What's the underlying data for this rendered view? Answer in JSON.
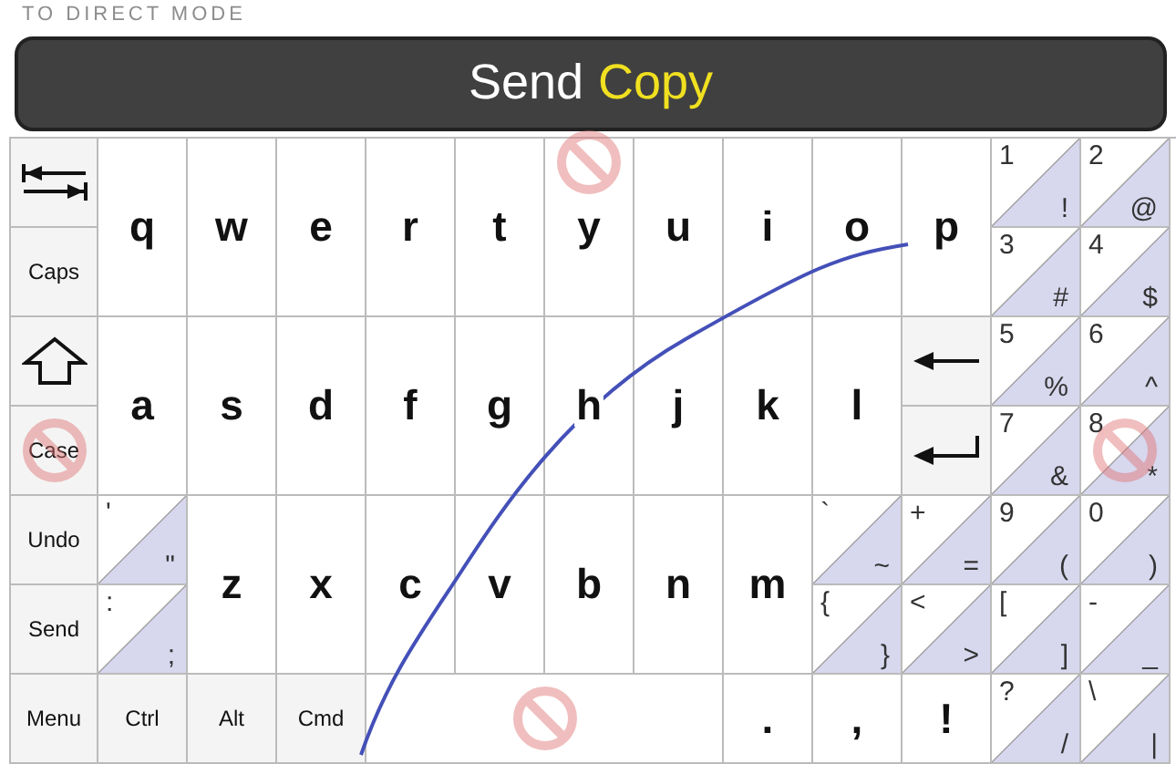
{
  "hint": "TO DIRECT MODE",
  "title": {
    "action": "Send",
    "mode": "Copy"
  },
  "keys": [
    {
      "kind": "tab"
    },
    {
      "kind": "letter",
      "label": "q"
    },
    {
      "kind": "letter",
      "label": "w"
    },
    {
      "kind": "letter",
      "label": "e"
    },
    {
      "kind": "letter",
      "label": "r"
    },
    {
      "kind": "letter",
      "label": "t"
    },
    {
      "kind": "letter",
      "label": "y",
      "blocked": true
    },
    {
      "kind": "letter",
      "label": "u"
    },
    {
      "kind": "letter",
      "label": "i"
    },
    {
      "kind": "letter",
      "label": "o"
    },
    {
      "kind": "letter",
      "label": "p"
    },
    {
      "kind": "split",
      "upper": "1",
      "lower": "!"
    },
    {
      "kind": "split",
      "upper": "2",
      "lower": "@"
    },
    {
      "kind": "label",
      "label": "Caps"
    },
    {
      "kind": "split",
      "upper": "3",
      "lower": "#"
    },
    {
      "kind": "split",
      "upper": "4",
      "lower": "$"
    },
    {
      "kind": "shift"
    },
    {
      "kind": "letter",
      "label": "a"
    },
    {
      "kind": "letter",
      "label": "s"
    },
    {
      "kind": "letter",
      "label": "d"
    },
    {
      "kind": "letter",
      "label": "f"
    },
    {
      "kind": "letter",
      "label": "g"
    },
    {
      "kind": "letter",
      "label": "h"
    },
    {
      "kind": "letter",
      "label": "j"
    },
    {
      "kind": "letter",
      "label": "k"
    },
    {
      "kind": "letter",
      "label": "l"
    },
    {
      "kind": "backspace"
    },
    {
      "kind": "split",
      "upper": "5",
      "lower": "%"
    },
    {
      "kind": "split",
      "upper": "6",
      "lower": "^"
    },
    {
      "kind": "label",
      "label": "Case",
      "blocked": true
    },
    {
      "kind": "enter"
    },
    {
      "kind": "split",
      "upper": "7",
      "lower": "&"
    },
    {
      "kind": "split",
      "upper": "8",
      "lower": "*",
      "blocked": true
    },
    {
      "kind": "label",
      "label": "Undo"
    },
    {
      "kind": "split",
      "upper": "'",
      "lower": "\""
    },
    {
      "kind": "letter",
      "label": "z"
    },
    {
      "kind": "letter",
      "label": "x"
    },
    {
      "kind": "letter",
      "label": "c"
    },
    {
      "kind": "letter",
      "label": "v"
    },
    {
      "kind": "letter",
      "label": "b"
    },
    {
      "kind": "letter",
      "label": "n"
    },
    {
      "kind": "letter",
      "label": "m"
    },
    {
      "kind": "split",
      "upper": "`",
      "lower": "~"
    },
    {
      "kind": "split",
      "upper": "+",
      "lower": "="
    },
    {
      "kind": "split",
      "upper": "9",
      "lower": "("
    },
    {
      "kind": "split",
      "upper": "0",
      "lower": ")"
    },
    {
      "kind": "label",
      "label": "Send"
    },
    {
      "kind": "split",
      "upper": ":",
      "lower": ";"
    },
    {
      "kind": "split",
      "upper": "{",
      "lower": "}"
    },
    {
      "kind": "split",
      "upper": "<",
      "lower": ">"
    },
    {
      "kind": "split",
      "upper": "[",
      "lower": "]"
    },
    {
      "kind": "split",
      "upper": "-",
      "lower": "_"
    },
    {
      "kind": "label",
      "label": "Menu"
    },
    {
      "kind": "label",
      "label": "Ctrl"
    },
    {
      "kind": "label",
      "label": "Alt"
    },
    {
      "kind": "label",
      "label": "Cmd"
    },
    {
      "kind": "space",
      "blocked": true
    },
    {
      "kind": "letter",
      "label": "."
    },
    {
      "kind": "letter",
      "label": ","
    },
    {
      "kind": "letter",
      "label": "!"
    },
    {
      "kind": "split",
      "upper": "?",
      "lower": "/"
    },
    {
      "kind": "split",
      "upper": "\\",
      "lower": "|"
    }
  ]
}
